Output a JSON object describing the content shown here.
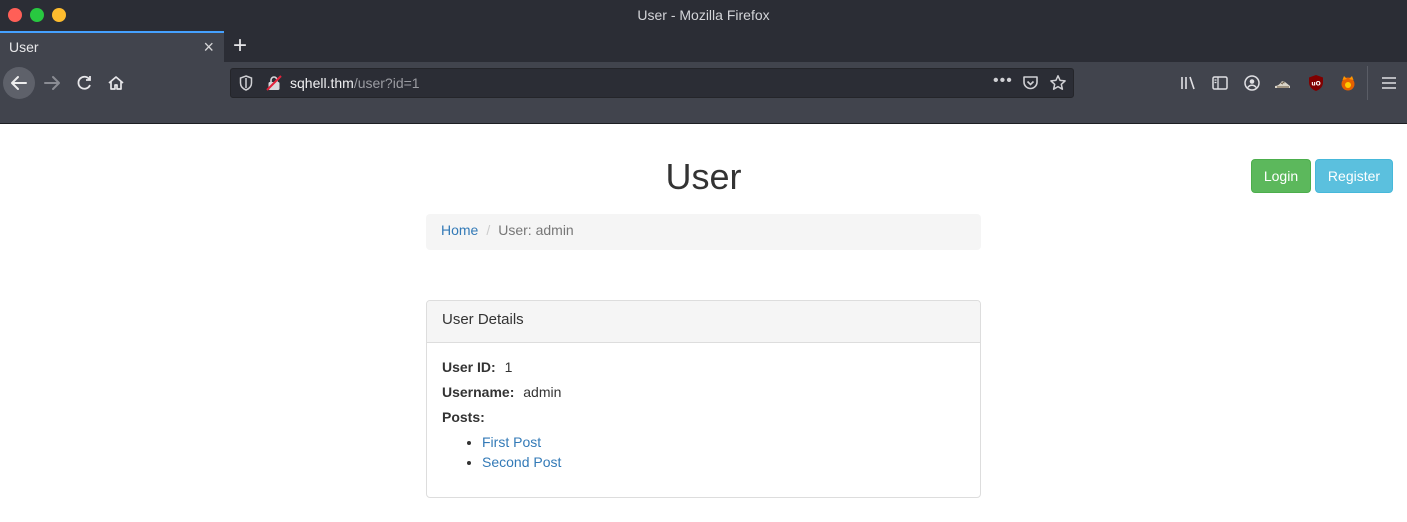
{
  "window": {
    "title": "User - Mozilla Firefox"
  },
  "tab": {
    "label": "User",
    "close": "×",
    "new_tab": "+"
  },
  "url": {
    "host": "sqhell.thm",
    "path": "/user?id=1",
    "dots": "•••"
  },
  "colors": {
    "login": "#5cb85c",
    "register": "#5bc0de",
    "link": "#337ab7",
    "chrome_dark": "#2b2d35",
    "chrome_mid": "#41444d"
  },
  "toolbar_icons": [
    "library-icon",
    "sidebar-icon",
    "account-icon",
    "extension-shoe-icon",
    "ublock-icon",
    "extension-fox-icon",
    "hamburger-menu-icon"
  ],
  "page": {
    "title": "User",
    "login_label": "Login",
    "register_label": "Register",
    "breadcrumb": {
      "home": "Home",
      "separator": "/",
      "current": "User: admin"
    },
    "panel": {
      "heading": "User Details",
      "user_id_label": "User ID:",
      "user_id_value": "1",
      "username_label": "Username:",
      "username_value": "admin",
      "posts_label": "Posts:",
      "posts": [
        "First Post",
        "Second Post"
      ]
    }
  }
}
